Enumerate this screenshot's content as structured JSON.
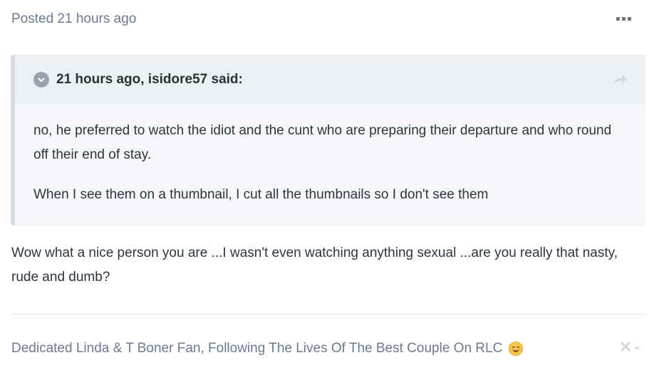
{
  "post": {
    "meta": "Posted 21 hours ago",
    "menu_icon": "ellipsis-icon"
  },
  "quote": {
    "citation": "21 hours ago, isidore57 said:",
    "toggle_icon": "chevron-down-circle-icon",
    "share_icon": "share-arrow-icon",
    "paragraphs": [
      "no, he preferred to watch the idiot and the cunt who are preparing their departure and who round off their end of stay.",
      "When I see them on a thumbnail, I cut all the thumbnails so I don't see them"
    ]
  },
  "reply": {
    "text": "Wow what a nice person you are ...I wasn't even watching anything sexual ...are you really that nasty, rude and dumb?"
  },
  "signature": {
    "text": "Dedicated Linda & T Boner Fan, Following The Lives Of The Best Couple On RLC",
    "emoji": "smiling-face-emoji",
    "controls_icon": "close-icon"
  },
  "colors": {
    "meta_text": "#6b7a90",
    "quote_bg": "#f5f7fa",
    "quote_header_bg": "#eceff3",
    "quote_border": "#d5dbe3",
    "body_text": "#2d3440"
  }
}
